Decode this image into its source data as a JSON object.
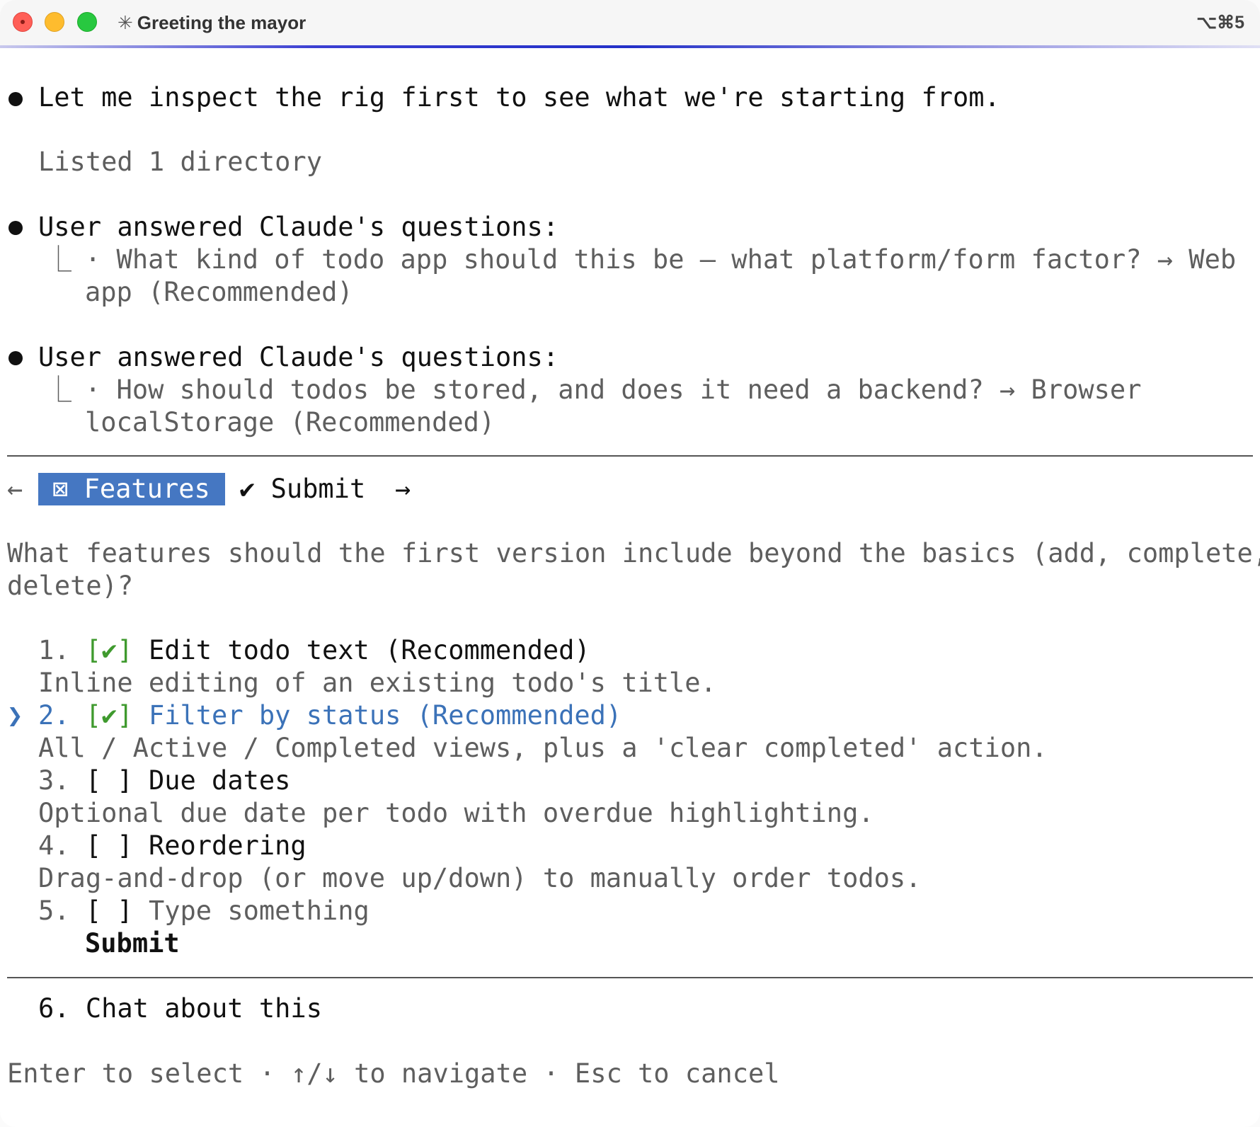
{
  "window": {
    "title": "Greeting the mayor",
    "title_icon": "✳",
    "shortcut": "⌥⌘5"
  },
  "transcript": {
    "msg1": "Let me inspect the rig first to see what we're starting from.",
    "tool1": "Listed 1 directory",
    "q1_header": "User answered Claude's questions:",
    "q1_line1": "· What kind of todo app should this be — what platform/form factor? → Web",
    "q1_line2": "app (Recommended)",
    "q2_header": "User answered Claude's questions:",
    "q2_line1": "· How should todos be stored, and does it need a backend? → Browser",
    "q2_line2": "localStorage (Recommended)"
  },
  "tabs": {
    "prev_arrow": "←",
    "features_icon": "⊠",
    "features": "Features",
    "submit_icon": "✔",
    "submit": "Submit",
    "next_arrow": "→"
  },
  "question": {
    "line1": "What features should the first version include beyond the basics (add, complete,",
    "line2": "delete)?"
  },
  "options": [
    {
      "num": "1.",
      "check": "[✔]",
      "label": "Edit todo text (Recommended)",
      "desc": "Inline editing of an existing todo's title."
    },
    {
      "num": "2.",
      "check": "[✔]",
      "label": "Filter by status (Recommended)",
      "desc": "All / Active / Completed views, plus a 'clear completed' action."
    },
    {
      "num": "3.",
      "check": "[ ]",
      "label": "Due dates",
      "desc": "Optional due date per todo with overdue highlighting."
    },
    {
      "num": "4.",
      "check": "[ ]",
      "label": "Reordering",
      "desc": "Drag-and-drop (or move up/down) to manually order todos."
    },
    {
      "num": "5.",
      "check": "[ ]",
      "label": "Type something"
    }
  ],
  "cursor": "❯",
  "submit_option": "Submit",
  "chat_option": "6. Chat about this",
  "footer": "Enter to select · ↑/↓ to navigate · Esc to cancel",
  "colors": {
    "accent_blue": "#4577c2",
    "check_green": "#3f9a2e",
    "selected_text": "#3b72b8"
  }
}
